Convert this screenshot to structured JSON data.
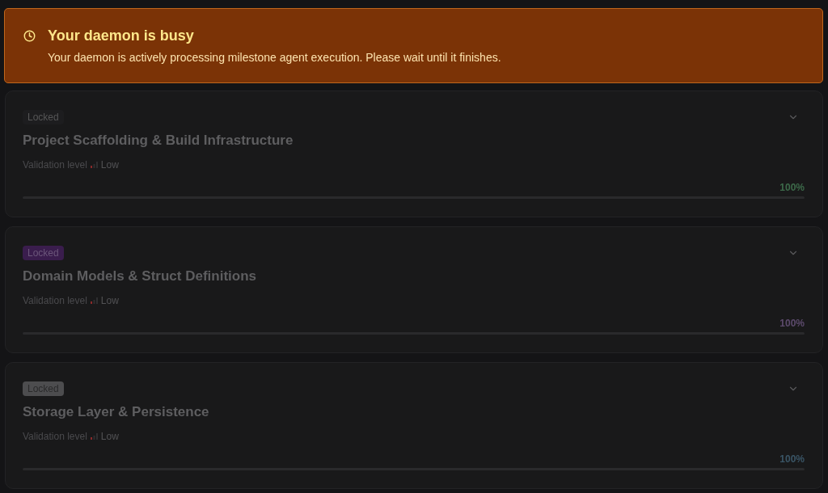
{
  "banner": {
    "title": "Your daemon is busy",
    "message": "Your daemon is actively processing milestone agent execution. Please wait until it finishes."
  },
  "milestones": [
    {
      "badge": {
        "label": "Locked",
        "color": "#1d1d1f"
      },
      "title": "Project Scaffolding & Build Infrastructure",
      "validation_label": "Validation level",
      "validation_value": "Low",
      "level": 1,
      "percent": "100%",
      "color": "#3d6a4a"
    },
    {
      "badge": {
        "label": "Locked",
        "color": "#3a1d4d"
      },
      "title": "Domain Models & Struct Definitions",
      "validation_label": "Validation level",
      "validation_value": "Low",
      "level": 1,
      "percent": "100%",
      "color": "#5c4a6c"
    },
    {
      "badge": {
        "label": "Locked",
        "color": "#4d4d4f"
      },
      "title": "Storage Layer & Persistence",
      "validation_label": "Validation level",
      "validation_value": "Low",
      "level": 1,
      "percent": "100%",
      "color": "#3a5566"
    }
  ]
}
